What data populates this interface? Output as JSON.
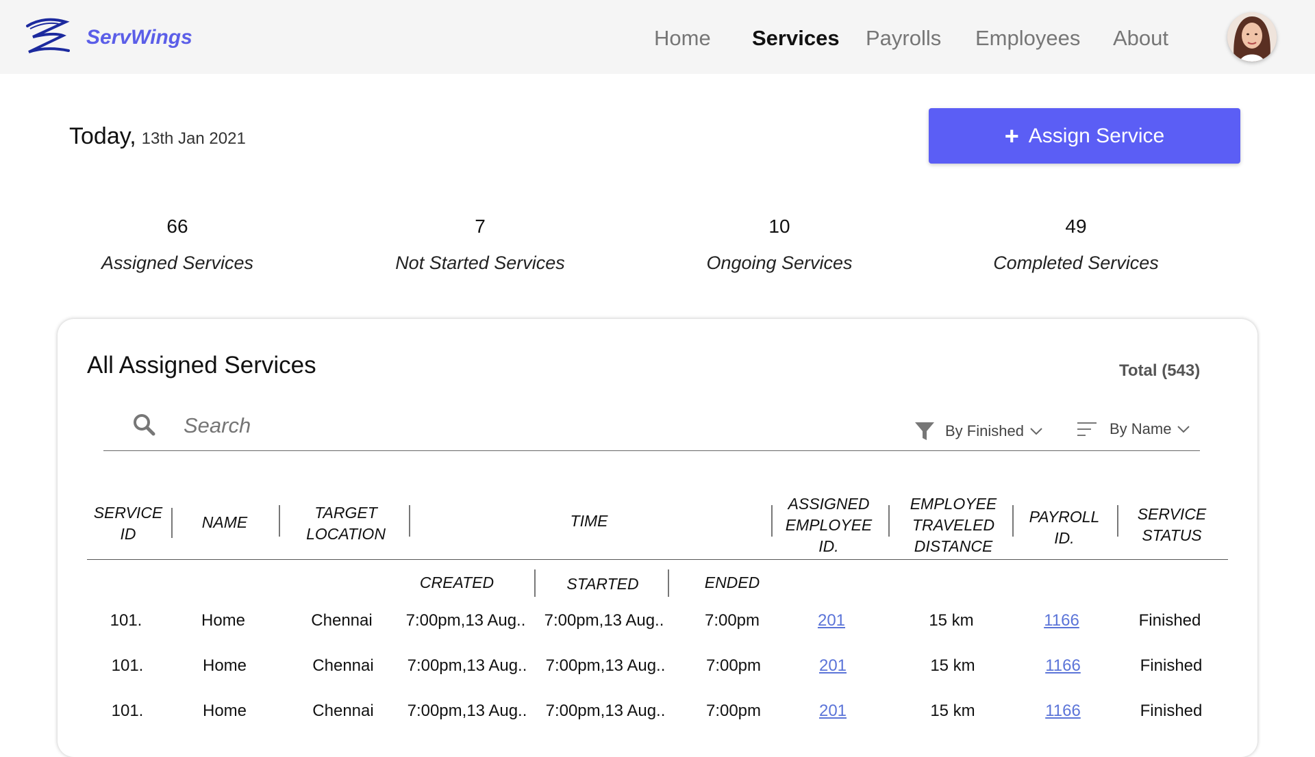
{
  "brand": {
    "name": "ServWings"
  },
  "nav": {
    "items": [
      "Home",
      "Services",
      "Payrolls",
      "Employees",
      "About"
    ],
    "active": "Services"
  },
  "today": {
    "label": "Today,",
    "date": "13th Jan 2021"
  },
  "assign_button": {
    "icon": "+",
    "label": "Assign Service"
  },
  "stats": [
    {
      "value": "66",
      "label": "Assigned Services"
    },
    {
      "value": "7",
      "label": "Not Started Services"
    },
    {
      "value": "10",
      "label": "Ongoing Services"
    },
    {
      "value": "49",
      "label": "Completed Services"
    }
  ],
  "card": {
    "title": "All Assigned Services",
    "total": "Total (543)"
  },
  "search": {
    "placeholder": "Search"
  },
  "filters": {
    "filter_label": "By Finished",
    "sort_label": "By Name"
  },
  "table": {
    "headers": {
      "service_id": [
        "SERVICE",
        "ID"
      ],
      "name": [
        "NAME"
      ],
      "target_location": [
        "TARGET",
        "LOCATION"
      ],
      "time": [
        "TIME"
      ],
      "assigned_employee": [
        "ASSIGNED",
        "EMPLOYEE",
        "ID."
      ],
      "distance": [
        "EMPLOYEE",
        "TRAVELED",
        "DISTANCE"
      ],
      "payroll": [
        "PAYROLL",
        "ID."
      ],
      "status": [
        "SERVICE",
        "STATUS"
      ]
    },
    "sub_headers": {
      "created": "CREATED",
      "started": "STARTED",
      "ended": "ENDED"
    },
    "rows": [
      {
        "id": "101.",
        "name": "Home",
        "location": "Chennai",
        "created": "7:00pm,13 Aug..",
        "started": "7:00pm,13 Aug..",
        "ended": "7:00pm",
        "employee": "201",
        "distance": "15 km",
        "payroll": "1166",
        "status": "Finished"
      },
      {
        "id": "101.",
        "name": "Home",
        "location": "Chennai",
        "created": "7:00pm,13 Aug..",
        "started": "7:00pm,13 Aug..",
        "ended": "7:00pm",
        "employee": "201",
        "distance": "15 km",
        "payroll": "1166",
        "status": "Finished"
      },
      {
        "id": "101.",
        "name": "Home",
        "location": "Chennai",
        "created": "7:00pm,13 Aug..",
        "started": "7:00pm,13 Aug..",
        "ended": "7:00pm",
        "employee": "201",
        "distance": "15 km",
        "payroll": "1166",
        "status": "Finished"
      }
    ]
  },
  "colors": {
    "accent": "#5b5ef5",
    "brand": "#5b5ee8",
    "link": "#5b74d8"
  },
  "icons": {
    "logo": "servwings-logo-icon",
    "search": "search-icon",
    "filter": "filter-icon",
    "sort": "sort-icon",
    "chevron": "chevron-down-icon"
  }
}
